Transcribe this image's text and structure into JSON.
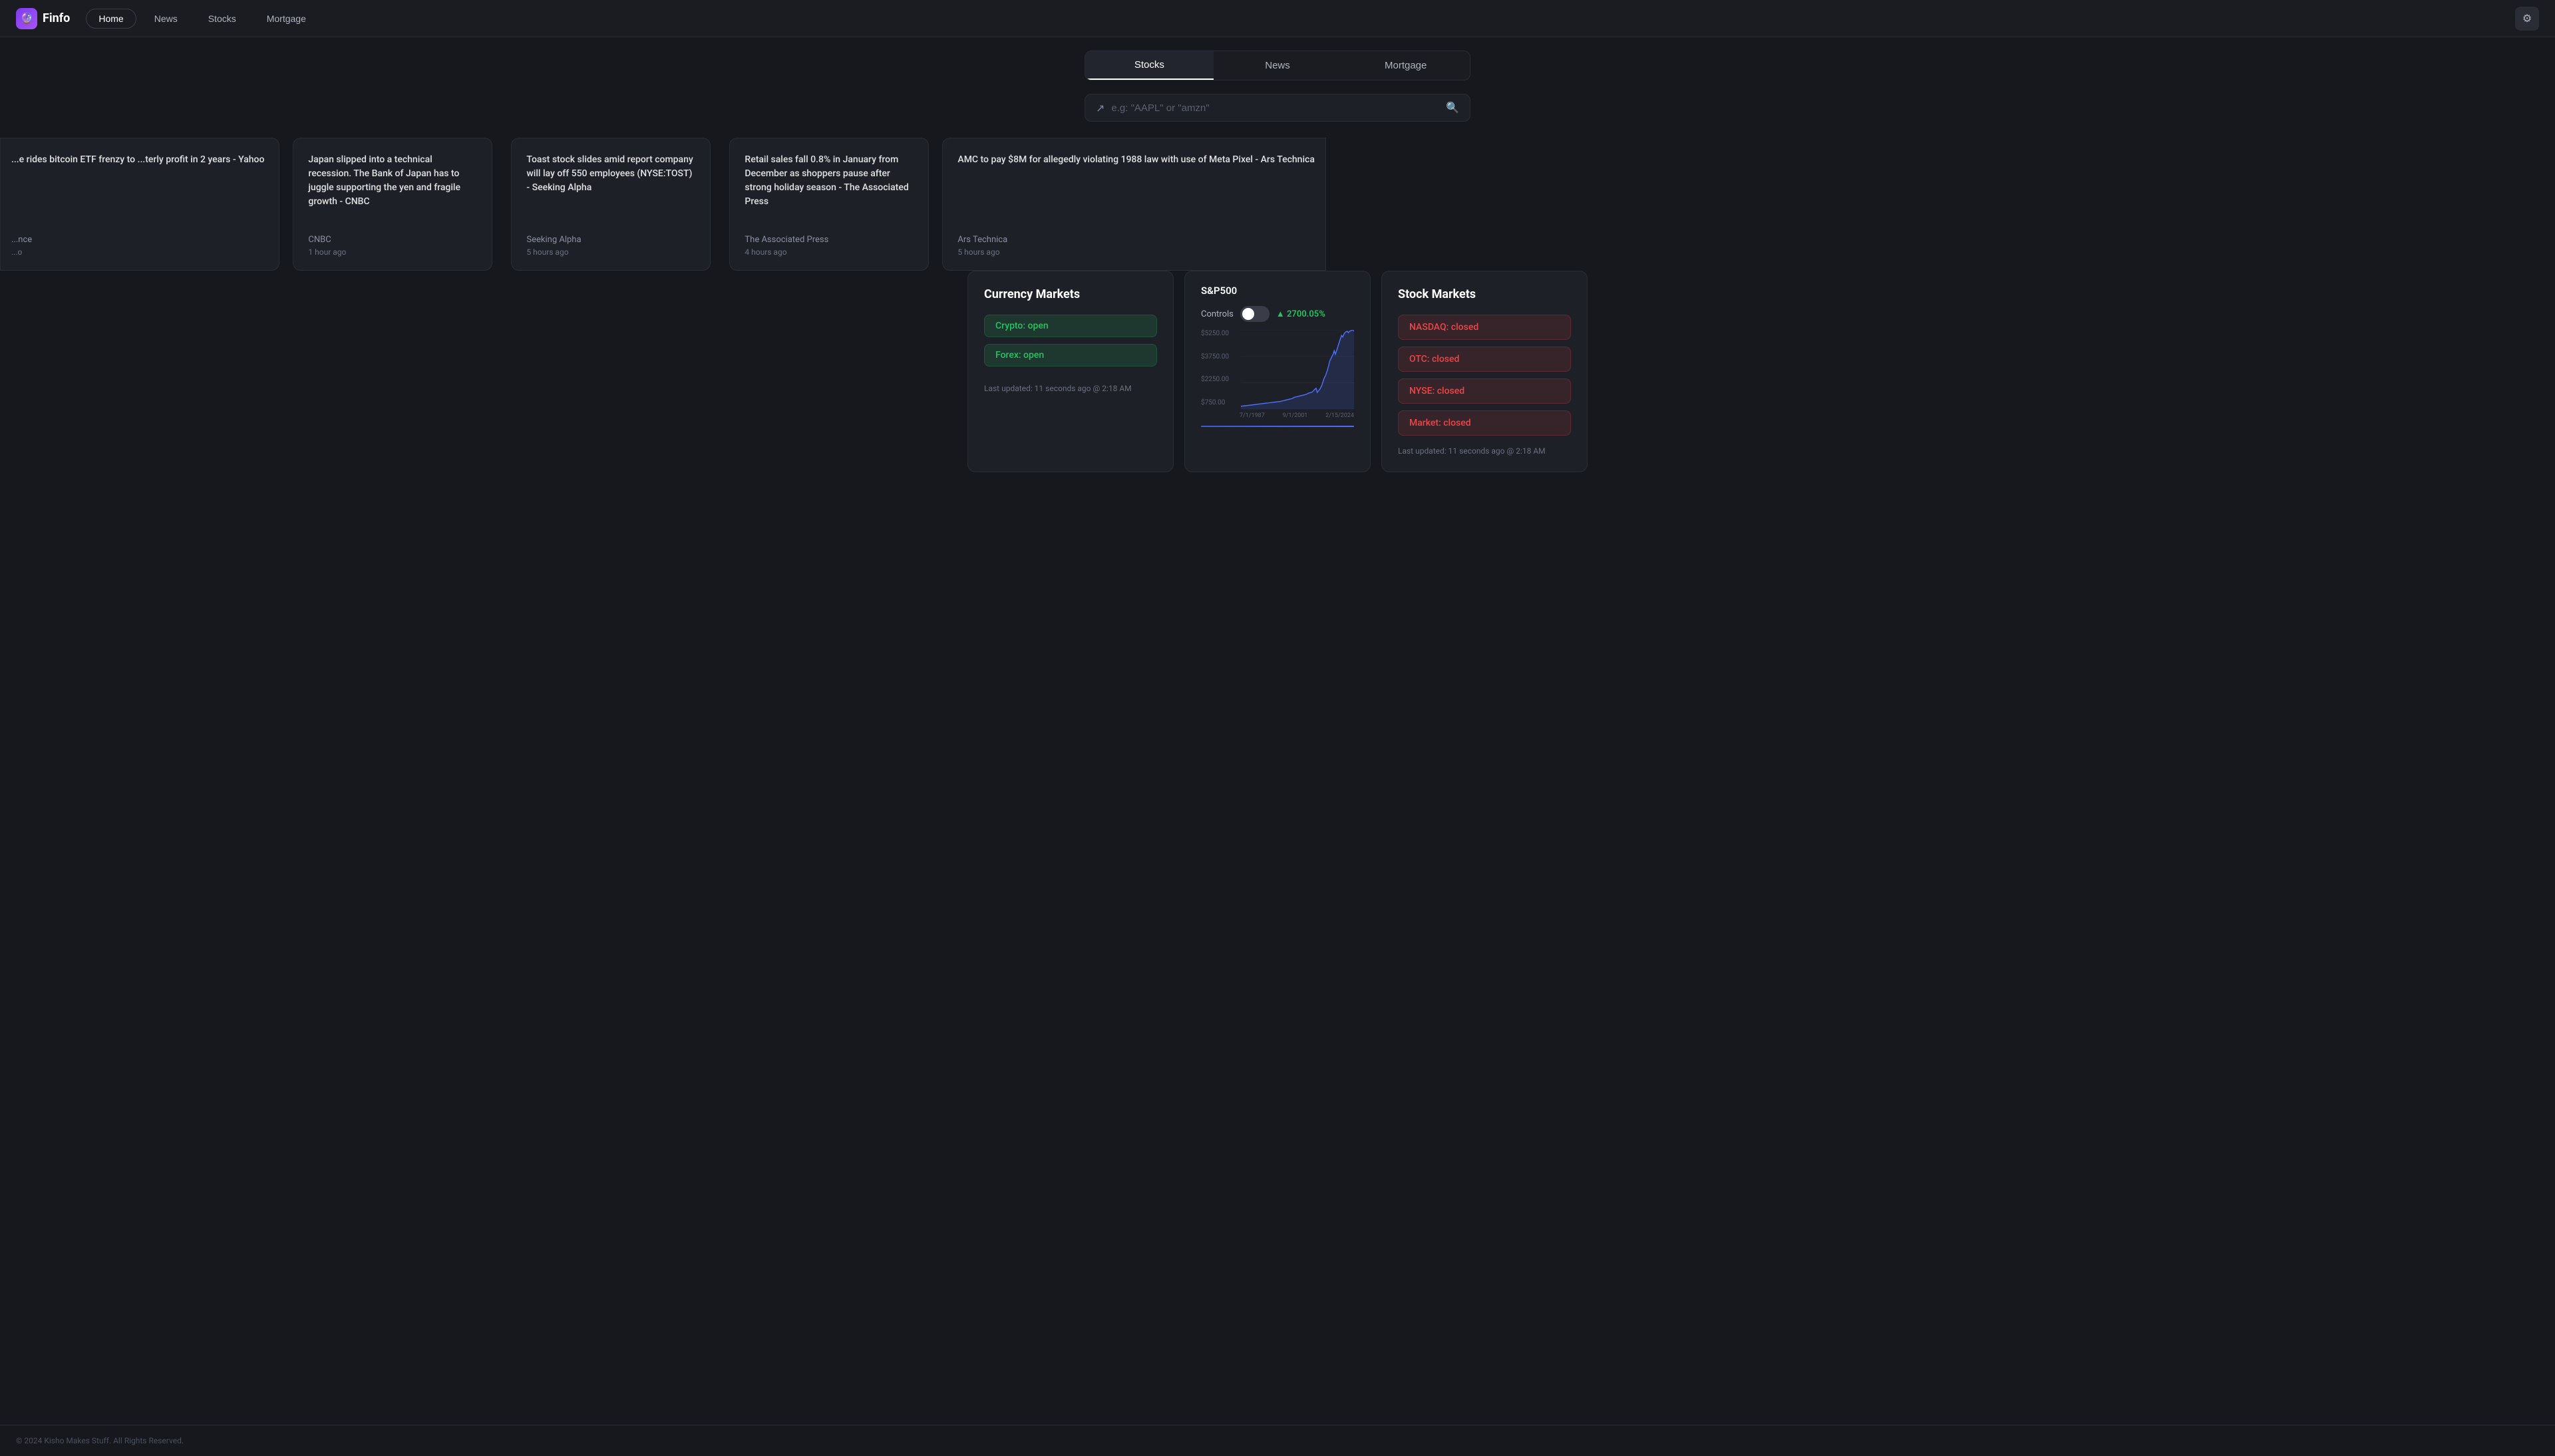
{
  "app": {
    "name": "Finfo",
    "logo_emoji": "🔮"
  },
  "navbar": {
    "home_label": "Home",
    "news_label": "News",
    "stocks_label": "Stocks",
    "mortgage_label": "Mortgage",
    "active_tab": "Home"
  },
  "tabs": {
    "stocks_label": "Stocks",
    "news_label": "News",
    "mortgage_label": "Mortgage",
    "active": "Stocks"
  },
  "search": {
    "placeholder": "e.g: \"AAPL\" or \"amzn\""
  },
  "news_cards": [
    {
      "title": "...e rides bitcoin ETF frenzy to ...terly profit in 2 years - Yahoo",
      "source": "...nce",
      "time": "...o",
      "partial_left": true
    },
    {
      "title": "Japan slipped into a technical recession. The Bank of Japan has to juggle supporting the yen and fragile growth - CNBC",
      "source": "CNBC",
      "time": "1 hour ago"
    },
    {
      "title": "Toast stock slides amid report company will lay off 550 employees (NYSE:TOST) - Seeking Alpha",
      "source": "Seeking Alpha",
      "time": "5 hours ago"
    },
    {
      "title": "Retail sales fall 0.8% in January from December as shoppers pause after strong holiday season - The Associated Press",
      "source": "The Associated Press",
      "time": "4 hours ago"
    },
    {
      "title": "AMC to pay $8M for allegedly violating 1988 law with use of Meta Pixel - Ars Technica",
      "source": "Ars Technica",
      "time": "5 hours ago",
      "partial_right": true
    }
  ],
  "currency_panel": {
    "title": "Currency Markets",
    "crypto_label": "Crypto: open",
    "forex_label": "Forex: open",
    "last_updated": "Last updated: 11 seconds ago @ 2:18 AM"
  },
  "chart_panel": {
    "title": "S&P500",
    "controls_label": "Controls",
    "percent_change": "▲ 2700.05%",
    "y_labels": [
      "$5250.00",
      "$3750.00",
      "$2250.00",
      "$750.00"
    ],
    "x_labels": [
      "7/1/1987",
      "9/1/2001",
      "2/15/2024"
    ],
    "chart_line_color": "#4c6ef5",
    "underline_color": "#3b5bdb"
  },
  "stock_panel": {
    "title": "Stock Markets",
    "items": [
      {
        "label": "NASDAQ: closed",
        "status": "closed"
      },
      {
        "label": "OTC: closed",
        "status": "closed"
      },
      {
        "label": "NYSE: closed",
        "status": "closed"
      },
      {
        "label": "Market: closed",
        "status": "closed"
      }
    ],
    "last_updated": "Last updated: 11 seconds ago @ 2:18 AM"
  },
  "footer": {
    "text": "© 2024 Kisho Makes Stuff. All Rights Reserved."
  },
  "colors": {
    "background": "#16181d",
    "card_bg": "#1e2028",
    "border": "#2a2d35",
    "accent_purple": "#7c3aed",
    "green": "#22c55e",
    "red": "#ef4444",
    "chart_blue": "#4c6ef5"
  }
}
